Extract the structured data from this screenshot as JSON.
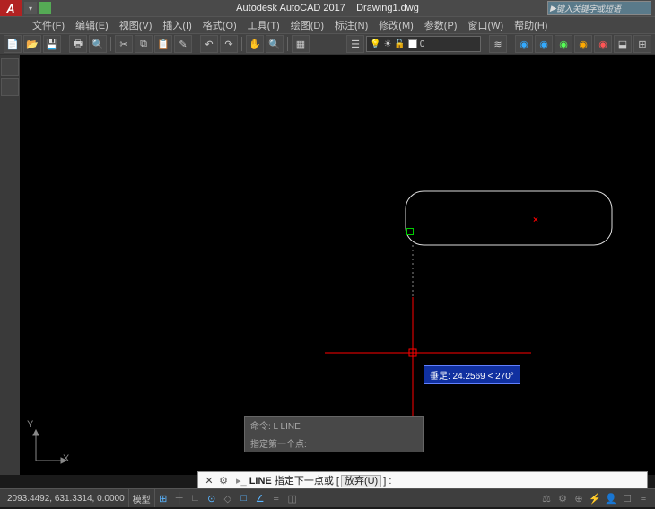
{
  "title": {
    "app": "Autodesk AutoCAD 2017",
    "doc": "Drawing1.dwg"
  },
  "search_placeholder": "键入关键字或短语",
  "menus": [
    "文件(F)",
    "编辑(E)",
    "视图(V)",
    "插入(I)",
    "格式(O)",
    "工具(T)",
    "绘图(D)",
    "标注(N)",
    "修改(M)",
    "参数(P)",
    "窗口(W)",
    "帮助(H)"
  ],
  "layer": {
    "name": "0"
  },
  "tooltip": "垂足: 24.2569 < 270°",
  "cmd_hist1": "命令: L LINE",
  "cmd_hist2": "指定第一个点:",
  "cmd_prefix": "× ",
  "cmd_cmd": "LINE",
  "cmd_text": "指定下一点或",
  "cmd_opt": "放弃(U)",
  "cmd_suffix": "] :",
  "status": {
    "coords": "2093.4492, 631.3314, 0.0000",
    "model": "模型"
  },
  "ucs": {
    "x": "X",
    "y": "Y"
  }
}
